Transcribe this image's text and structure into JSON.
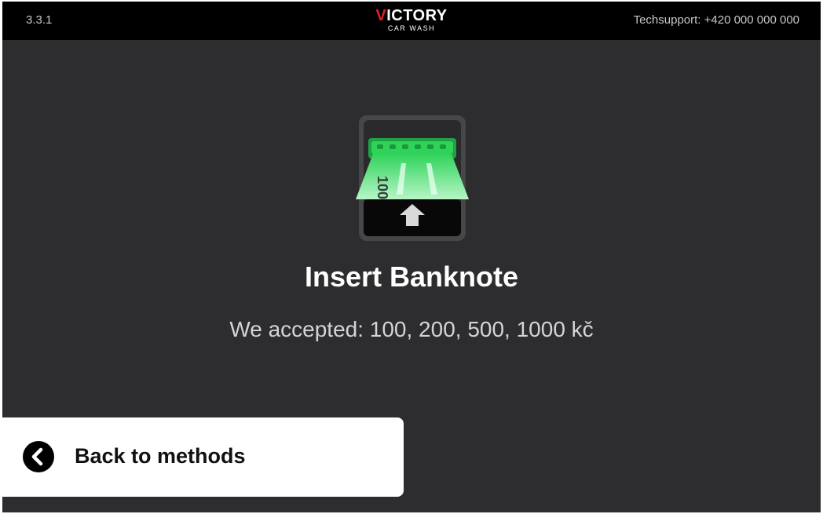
{
  "header": {
    "version": "3.3.1",
    "logo_accent": "V",
    "logo_main": "ICTORY",
    "logo_sub": "CAR WASH",
    "techsupport": "Techsupport: +420 000 000 000"
  },
  "main": {
    "icon": "banknote-insert-icon",
    "banknote_value": "100",
    "title": "Insert Banknote",
    "subtitle": "We accepted: 100, 200, 500, 1000 kč"
  },
  "back": {
    "label": "Back to methods",
    "icon": "chevron-left-circle-icon"
  },
  "colors": {
    "background": "#2d2d30",
    "header": "#000000",
    "accent_green": "#2fd35a",
    "logo_red": "#e0202c",
    "button_bg": "#ffffff"
  }
}
